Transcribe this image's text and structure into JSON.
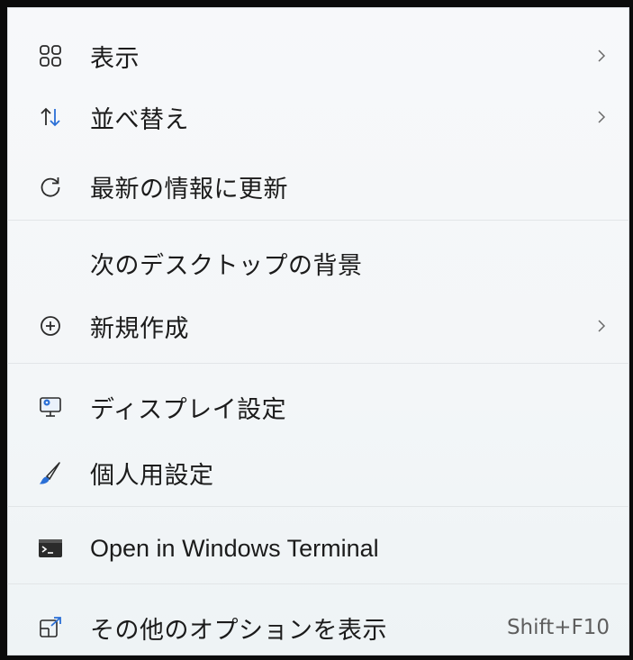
{
  "menu": {
    "items": [
      {
        "label": "表示",
        "icon": "grid-view-icon",
        "submenu": true
      },
      {
        "label": "並べ替え",
        "icon": "sort-arrows-icon",
        "submenu": true
      },
      {
        "label": "最新の情報に更新",
        "icon": "refresh-icon",
        "submenu": false
      },
      {
        "label": "次のデスクトップの背景",
        "icon": "",
        "submenu": false
      },
      {
        "label": "新規作成",
        "icon": "plus-circle-icon",
        "submenu": true
      },
      {
        "label": "ディスプレイ設定",
        "icon": "display-settings-icon",
        "submenu": false
      },
      {
        "label": "個人用設定",
        "icon": "brush-icon",
        "submenu": false
      },
      {
        "label": "Open in Windows Terminal",
        "icon": "terminal-icon",
        "submenu": false
      },
      {
        "label": "その他のオプションを表示",
        "icon": "more-options-icon",
        "submenu": false,
        "shortcut": "Shift+F10"
      }
    ]
  },
  "colors": {
    "background": "#f5f7f9",
    "text": "#1b1b1b",
    "separator": "#e2e5e8",
    "accent": "#2a6fd6"
  }
}
